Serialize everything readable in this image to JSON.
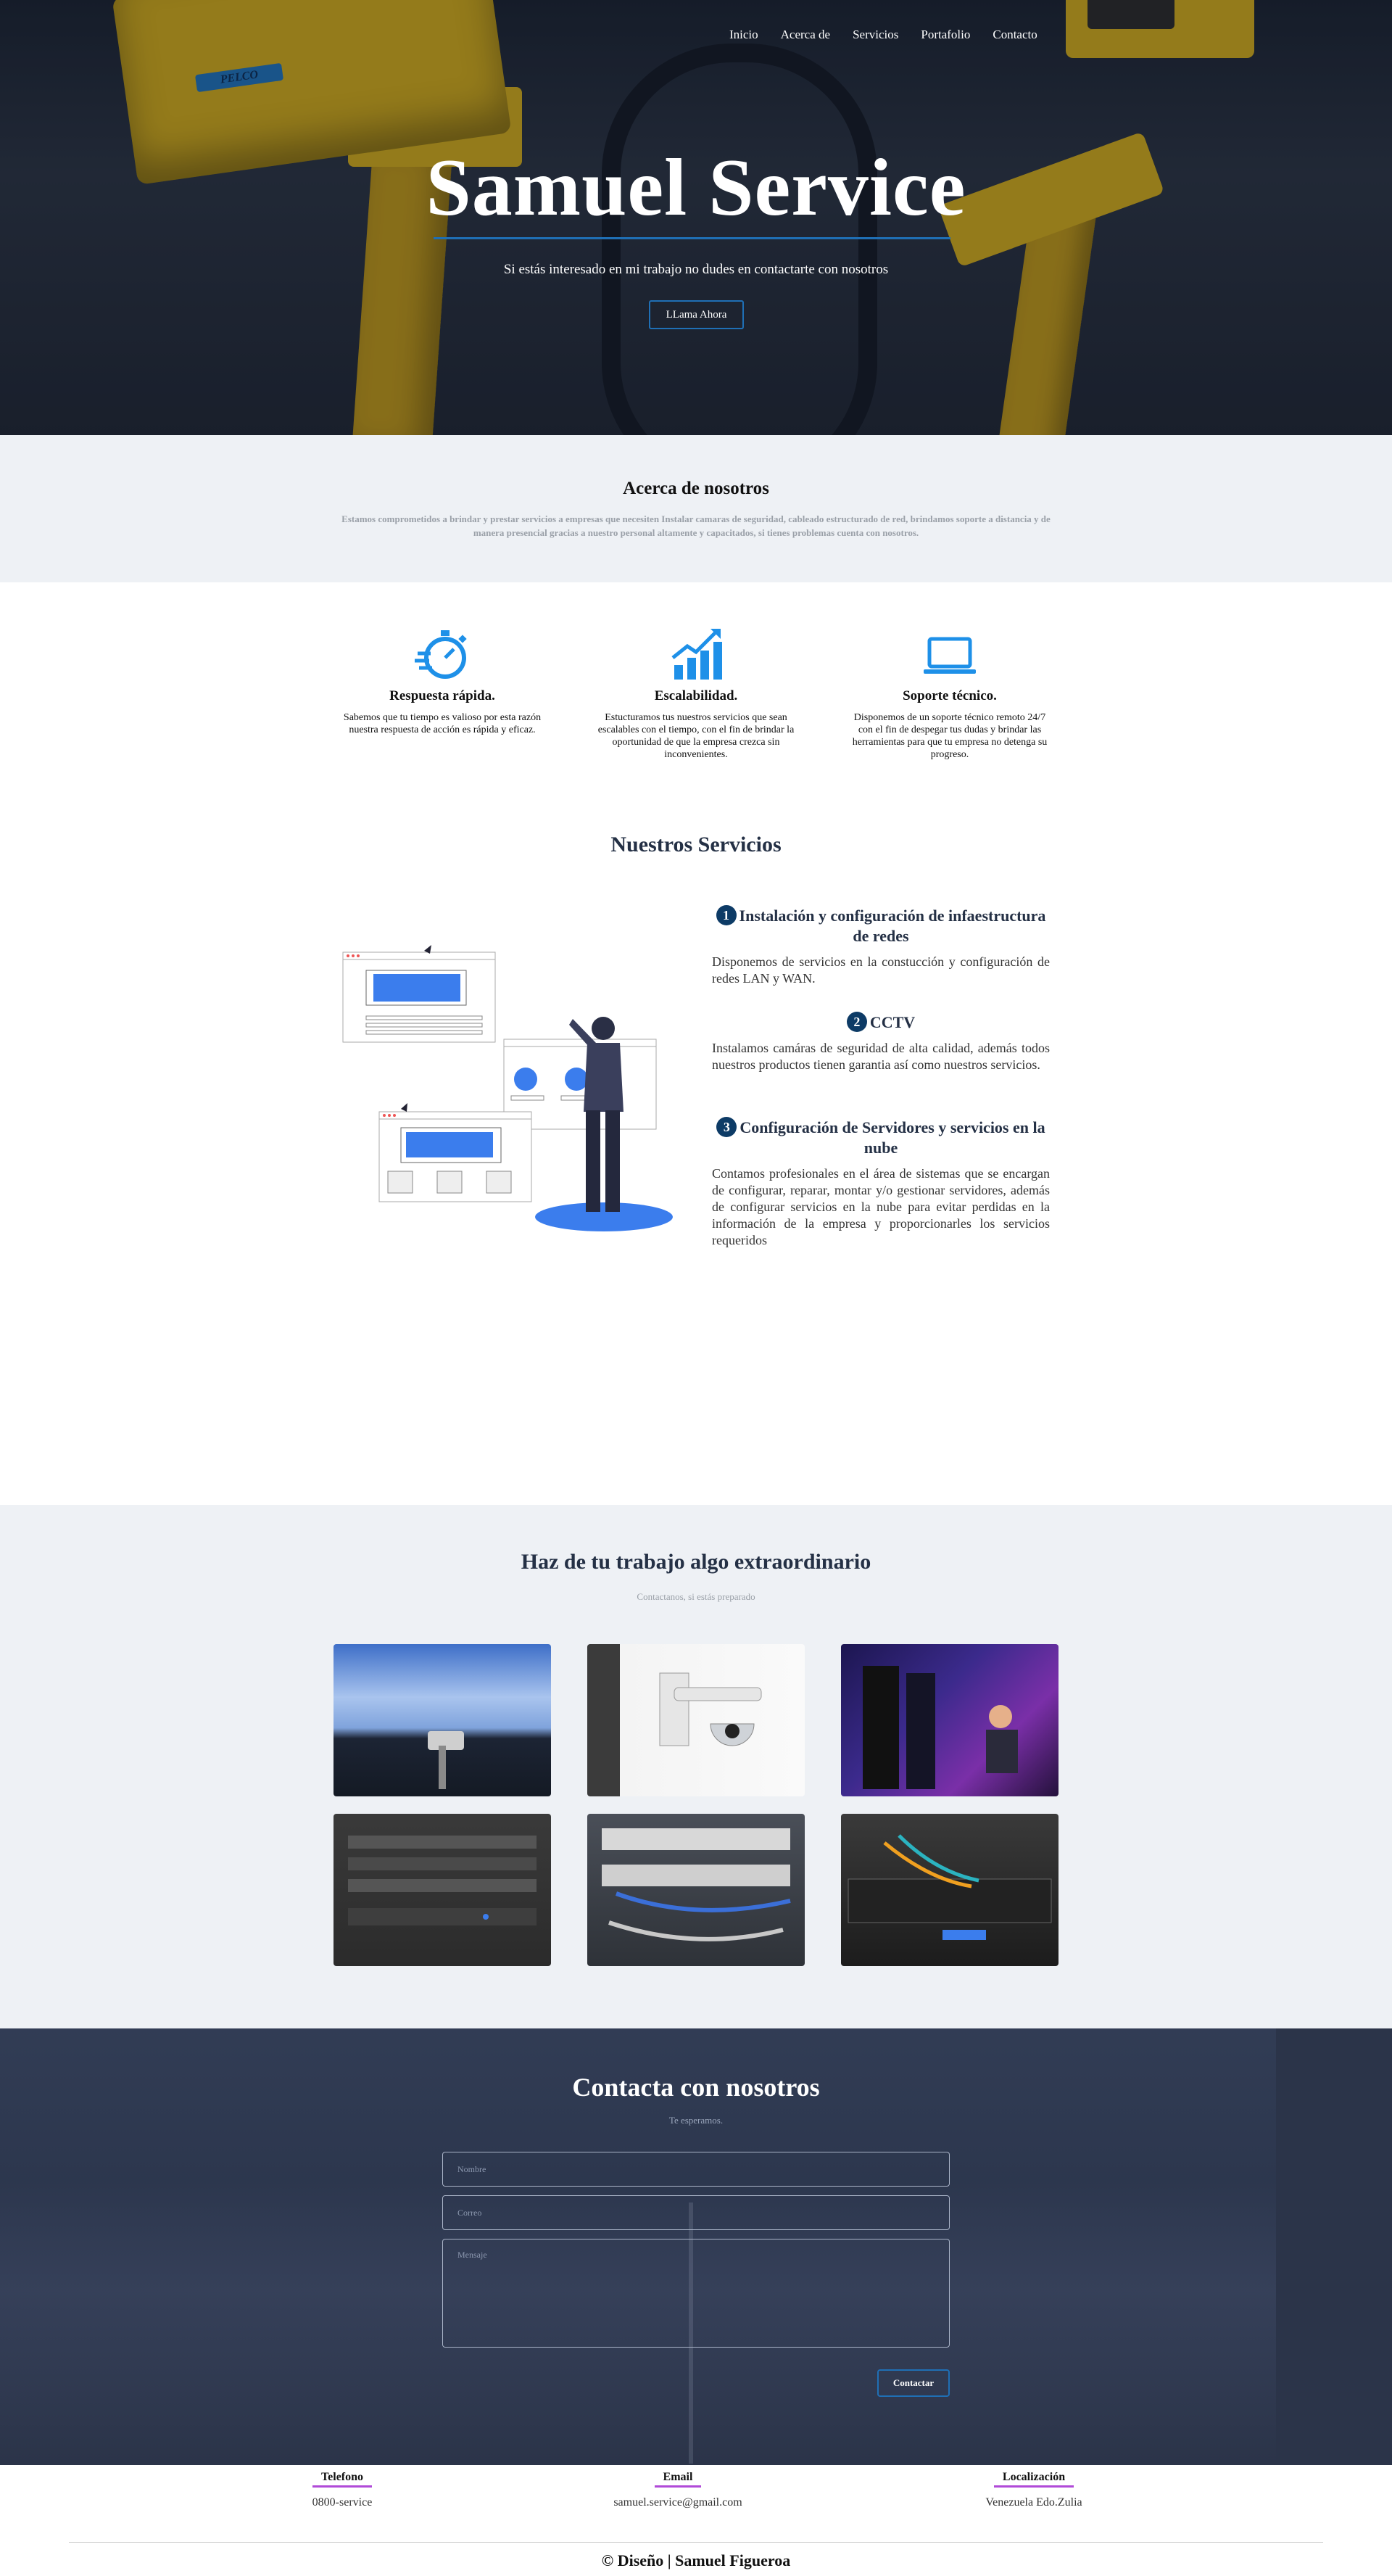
{
  "nav": {
    "items": [
      "Inicio",
      "Acerca de",
      "Servicios",
      "Portafolio",
      "Contacto"
    ]
  },
  "hero": {
    "title": "Samuel Service",
    "subtitle": "Si estás interesado en mi trabajo no dudes en contactarte con nosotros",
    "cta_label": "LLama Ahora",
    "camera_brand": "PELCO",
    "accent_color": "#1f6fb5"
  },
  "about": {
    "title": "Acerca de nosotros",
    "text": "Estamos comprometidos a brindar y prestar servicios a empresas que necesiten Instalar camaras de seguridad, cableado estructurado de red, brindamos soporte a distancia y de manera presencial gracias a nuestro personal altamente y capacitados, si tienes problemas cuenta con nosotros."
  },
  "features": [
    {
      "icon": "stopwatch-icon",
      "title": "Respuesta rápida.",
      "text": "Sabemos que tu tiempo es valioso por esta razón nuestra respuesta de acción es rápida y eficaz."
    },
    {
      "icon": "growth-chart-icon",
      "title": "Escalabilidad.",
      "text": "Estucturamos tus nuestros servicios que sean escalables con el tiempo, con el fin de brindar la oportunidad de que la empresa crezca sin inconvenientes."
    },
    {
      "icon": "laptop-icon",
      "title": "Soporte técnico.",
      "text": "Disponemos de un soporte técnico remoto 24/7 con el fin de despegar tus dudas y brindar las herramientas para que tu empresa no detenga su progreso."
    }
  ],
  "services": {
    "title": "Nuestros Servicios",
    "items": [
      {
        "num": "1",
        "title": "Instalación y configuración de infaestructura de redes",
        "text": "Disponemos de servicios en la constucción y configuración de redes LAN y WAN."
      },
      {
        "num": "2",
        "title": "CCTV",
        "text": "Instalamos camáras de seguridad de alta calidad, además todos nuestros productos tienen garantia así como nuestros servicios."
      },
      {
        "num": "3",
        "title": "Configuración de Servidores y servicios en la nube",
        "text": "Contamos profesionales en el área de sistemas que se encargan de configurar, reparar, montar y/o gestionar servidores, además de configurar servicios en la nube para evitar perdidas en la información de la empresa y proporcionarles los servicios requeridos"
      }
    ]
  },
  "work": {
    "title": "Haz de tu trabajo algo extraordinario",
    "subtitle": "Contactanos, si estás preparado",
    "photos": [
      "camera-sky-photo",
      "dome-camera-photo",
      "server-room-photo",
      "rack-equipment-photo",
      "patch-panel-photo",
      "fiber-switch-photo"
    ]
  },
  "contact": {
    "title": "Contacta con nosotros",
    "subtitle": "Te esperamos.",
    "name_placeholder": "Nombre",
    "email_placeholder": "Correo",
    "message_placeholder": "Mensaje",
    "submit_label": "Contactar"
  },
  "footer": {
    "phone_label": "Telefono",
    "phone_value": "0800-service",
    "email_label": "Email",
    "email_value": "samuel.service@gmail.com",
    "location_label": "Localización",
    "location_value": "Venezuela Edo.Zulia",
    "credit": "© Diseño | Samuel Figueroa"
  }
}
